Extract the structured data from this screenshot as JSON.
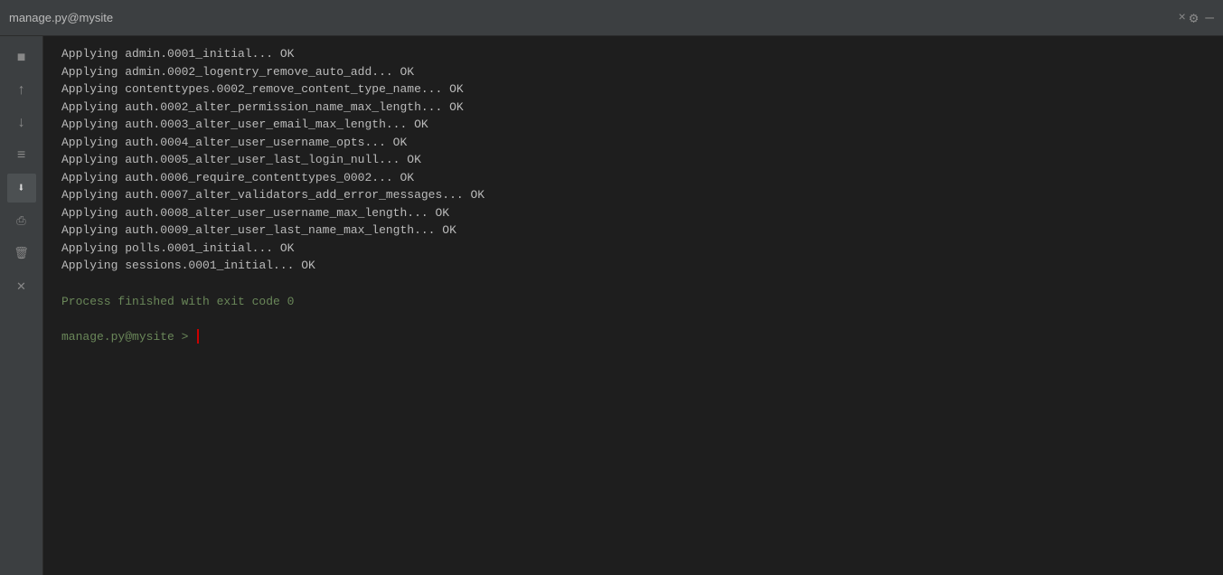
{
  "titleBar": {
    "title": "manage.py@mysite",
    "closeLabel": "×"
  },
  "sidebar": {
    "buttons": [
      {
        "id": "stop",
        "icon": "■",
        "label": "stop"
      },
      {
        "id": "scroll-up",
        "icon": "↑",
        "label": "scroll-up"
      },
      {
        "id": "scroll-down",
        "icon": "↓",
        "label": "scroll-down"
      },
      {
        "id": "wrap",
        "icon": "≡",
        "label": "wrap-lines"
      },
      {
        "id": "save-output",
        "icon": "⬇",
        "label": "save-output",
        "active": true
      },
      {
        "id": "print",
        "icon": "🖨",
        "label": "print"
      },
      {
        "id": "clear",
        "icon": "🗑",
        "label": "clear"
      },
      {
        "id": "close",
        "icon": "✕",
        "label": "close"
      }
    ]
  },
  "terminal": {
    "lines": [
      {
        "applying": "Applying",
        "rest": " admin.0001_initial... OK"
      },
      {
        "applying": "Applying",
        "rest": " admin.0002_logentry_remove_auto_add... OK"
      },
      {
        "applying": "Applying",
        "rest": " contenttypes.0002_remove_content_type_name... OK"
      },
      {
        "applying": "Applying",
        "rest": " auth.0002_alter_permission_name_max_length... OK"
      },
      {
        "applying": "Applying",
        "rest": " auth.0003_alter_user_email_max_length... OK"
      },
      {
        "applying": "Applying",
        "rest": " auth.0004_alter_user_username_opts... OK"
      },
      {
        "applying": "Applying",
        "rest": " auth.0005_alter_user_last_login_null... OK"
      },
      {
        "applying": "Applying",
        "rest": " auth.0006_require_contenttypes_0002... OK"
      },
      {
        "applying": "Applying",
        "rest": " auth.0007_alter_validators_add_error_messages... OK"
      },
      {
        "applying": "Applying",
        "rest": " auth.0008_alter_user_username_max_length... OK"
      },
      {
        "applying": "Applying",
        "rest": " auth.0009_alter_user_last_name_max_length... OK"
      },
      {
        "applying": "Applying",
        "rest": " polls.0001_initial... OK"
      },
      {
        "applying": "Applying",
        "rest": " sessions.0001_initial... OK"
      }
    ],
    "processFinished": "Process finished with exit code 0",
    "prompt": "manage.py@mysite >",
    "gearIcon": "⚙",
    "minimizeIcon": "—"
  }
}
